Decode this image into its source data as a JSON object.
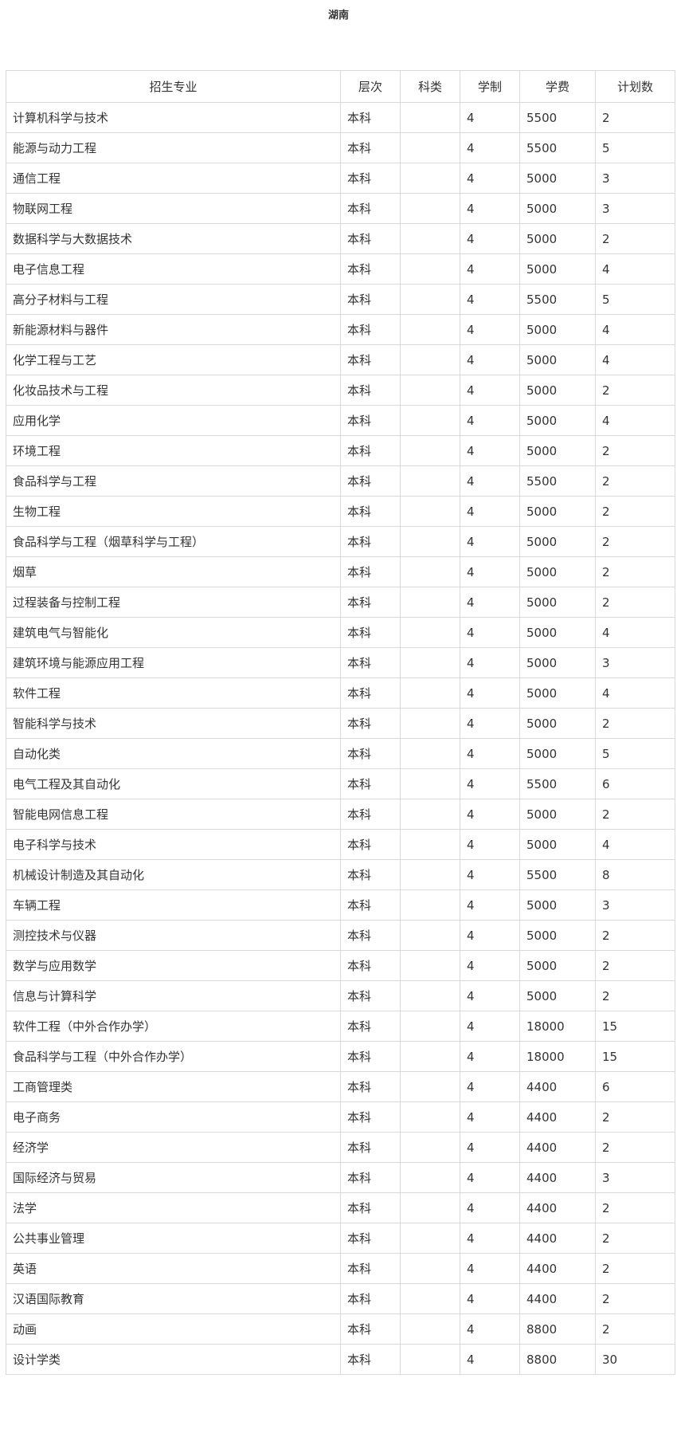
{
  "title": "湖南",
  "table": {
    "headers": [
      "招生专业",
      "层次",
      "科类",
      "学制",
      "学费",
      "计划数"
    ],
    "rows": [
      [
        "计算机科学与技术",
        "本科",
        "",
        "4",
        "5500",
        "2"
      ],
      [
        "能源与动力工程",
        "本科",
        "",
        "4",
        "5500",
        "5"
      ],
      [
        "通信工程",
        "本科",
        "",
        "4",
        "5000",
        "3"
      ],
      [
        "物联网工程",
        "本科",
        "",
        "4",
        "5000",
        "3"
      ],
      [
        "数据科学与大数据技术",
        "本科",
        "",
        "4",
        "5000",
        "2"
      ],
      [
        "电子信息工程",
        "本科",
        "",
        "4",
        "5000",
        "4"
      ],
      [
        "高分子材料与工程",
        "本科",
        "",
        "4",
        "5500",
        "5"
      ],
      [
        "新能源材料与器件",
        "本科",
        "",
        "4",
        "5000",
        "4"
      ],
      [
        "化学工程与工艺",
        "本科",
        "",
        "4",
        "5000",
        "4"
      ],
      [
        "化妆品技术与工程",
        "本科",
        "",
        "4",
        "5000",
        "2"
      ],
      [
        "应用化学",
        "本科",
        "",
        "4",
        "5000",
        "4"
      ],
      [
        "环境工程",
        "本科",
        "",
        "4",
        "5000",
        "2"
      ],
      [
        "食品科学与工程",
        "本科",
        "",
        "4",
        "5500",
        "2"
      ],
      [
        "生物工程",
        "本科",
        "",
        "4",
        "5000",
        "2"
      ],
      [
        "食品科学与工程（烟草科学与工程）",
        "本科",
        "",
        "4",
        "5000",
        "2"
      ],
      [
        "烟草",
        "本科",
        "",
        "4",
        "5000",
        "2"
      ],
      [
        "过程装备与控制工程",
        "本科",
        "",
        "4",
        "5000",
        "2"
      ],
      [
        "建筑电气与智能化",
        "本科",
        "",
        "4",
        "5000",
        "4"
      ],
      [
        "建筑环境与能源应用工程",
        "本科",
        "",
        "4",
        "5000",
        "3"
      ],
      [
        "软件工程",
        "本科",
        "",
        "4",
        "5000",
        "4"
      ],
      [
        "智能科学与技术",
        "本科",
        "",
        "4",
        "5000",
        "2"
      ],
      [
        "自动化类",
        "本科",
        "",
        "4",
        "5000",
        "5"
      ],
      [
        "电气工程及其自动化",
        "本科",
        "",
        "4",
        "5500",
        "6"
      ],
      [
        "智能电网信息工程",
        "本科",
        "",
        "4",
        "5000",
        "2"
      ],
      [
        "电子科学与技术",
        "本科",
        "",
        "4",
        "5000",
        "4"
      ],
      [
        "机械设计制造及其自动化",
        "本科",
        "",
        "4",
        "5500",
        "8"
      ],
      [
        "车辆工程",
        "本科",
        "",
        "4",
        "5000",
        "3"
      ],
      [
        "测控技术与仪器",
        "本科",
        "",
        "4",
        "5000",
        "2"
      ],
      [
        "数学与应用数学",
        "本科",
        "",
        "4",
        "5000",
        "2"
      ],
      [
        "信息与计算科学",
        "本科",
        "",
        "4",
        "5000",
        "2"
      ],
      [
        "软件工程（中外合作办学）",
        "本科",
        "",
        "4",
        "18000",
        "15"
      ],
      [
        "食品科学与工程（中外合作办学）",
        "本科",
        "",
        "4",
        "18000",
        "15"
      ],
      [
        "工商管理类",
        "本科",
        "",
        "4",
        "4400",
        "6"
      ],
      [
        "电子商务",
        "本科",
        "",
        "4",
        "4400",
        "2"
      ],
      [
        "经济学",
        "本科",
        "",
        "4",
        "4400",
        "2"
      ],
      [
        "国际经济与贸易",
        "本科",
        "",
        "4",
        "4400",
        "3"
      ],
      [
        "法学",
        "本科",
        "",
        "4",
        "4400",
        "2"
      ],
      [
        "公共事业管理",
        "本科",
        "",
        "4",
        "4400",
        "2"
      ],
      [
        "英语",
        "本科",
        "",
        "4",
        "4400",
        "2"
      ],
      [
        "汉语国际教育",
        "本科",
        "",
        "4",
        "4400",
        "2"
      ],
      [
        "动画",
        "本科",
        "",
        "4",
        "8800",
        "2"
      ],
      [
        "设计学类",
        "本科",
        "",
        "4",
        "8800",
        "30"
      ]
    ]
  }
}
